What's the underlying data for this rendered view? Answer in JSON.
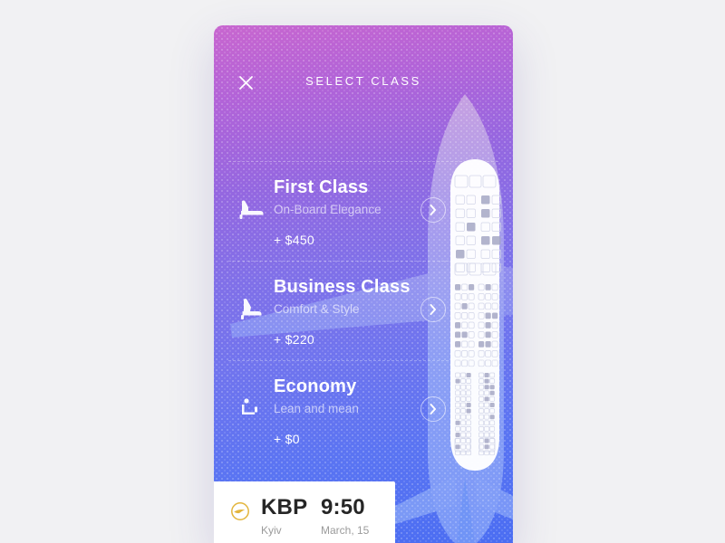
{
  "page": {
    "background_color": "#f1f1f3",
    "card_gradient_from": "#c866cf",
    "card_gradient_to": "#4a6df2"
  },
  "header": {
    "title": "SELECT CLASS",
    "close_icon": "close-icon"
  },
  "classes": [
    {
      "id": "first-class",
      "title": "First Class",
      "subtitle": "On-Board Elegance",
      "price": "+ $450",
      "seat_icon": "seat-flat-recline-icon",
      "action_icon": "chevron-right-icon"
    },
    {
      "id": "business-class",
      "title": "Business Class",
      "subtitle": "Comfort & Style",
      "price": "+ $220",
      "seat_icon": "seat-recline-icon",
      "action_icon": "chevron-right-icon"
    },
    {
      "id": "economy",
      "title": "Economy",
      "subtitle": "Lean and mean",
      "price": "+ $0",
      "seat_icon": "seat-upright-icon",
      "action_icon": "chevron-right-icon"
    }
  ],
  "ticket": {
    "airline_logo_icon": "lufthansa-crane-icon",
    "airline_logo_color": "#e3b53c",
    "airport_code": "KBP",
    "city": "Kyiv",
    "time": "9:50",
    "date": "March, 15"
  },
  "illustration": {
    "plane_icon": "airplane-top-view-icon",
    "seatmap_icon": "cabin-seatmap-icon",
    "amenity_icons": [
      "wc-icon",
      "wifi-icon",
      "galley-icon"
    ]
  }
}
